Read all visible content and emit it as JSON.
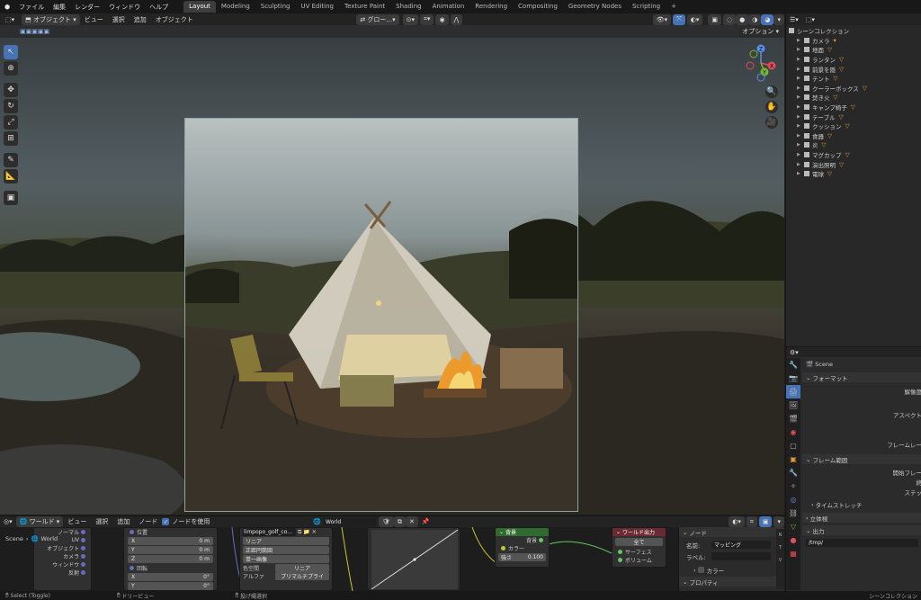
{
  "menubar": {
    "items": [
      "ファイル",
      "編集",
      "レンダー",
      "ウィンドウ",
      "ヘルプ"
    ],
    "workspaces": [
      "Layout",
      "Modeling",
      "Sculpting",
      "UV Editing",
      "Texture Paint",
      "Shading",
      "Animation",
      "Rendering",
      "Compositing",
      "Geometry Nodes",
      "Scripting"
    ],
    "add_tab": "+"
  },
  "viewport": {
    "mode": "オブジェクト",
    "menus": [
      "ビュー",
      "選択",
      "追加",
      "オブジェクト"
    ],
    "transform": "グロー...",
    "options": "オプション"
  },
  "gizmo": {
    "z": "Z",
    "x": "X",
    "y": "Y"
  },
  "outliner": {
    "title": "シーンコレクション",
    "items": [
      "カメラ",
      "地面",
      "ランタン",
      "前景を隠",
      "テント",
      "クーラーボックス",
      "焚き火",
      "キャンプ椅子",
      "テーブル",
      "クッション",
      "食器",
      "炎",
      "マグカップ",
      "演出照明",
      "電球"
    ]
  },
  "properties": {
    "scene": "Scene",
    "format_section": "フォーマット",
    "labels": [
      "解像度",
      "アスペクト",
      "フレームレー"
    ],
    "frame_range": "フレーム範囲",
    "frame_labels": [
      "開始フレー",
      "終",
      "ステッ"
    ],
    "time_stretch": "タイムストレッチ",
    "stereo": "立体視",
    "output": "出力",
    "output_path": "/tmp/"
  },
  "node_editor": {
    "world_dropdown": "ワールド",
    "menus": [
      "ビュー",
      "選択",
      "追加",
      "ノード"
    ],
    "use_nodes": "ノードを使用",
    "world_name": "World",
    "scene_label": "Scene",
    "tree": [
      "ノーマル",
      "UV",
      "オブジェクト",
      "カメラ",
      "ウィンドウ",
      "反射"
    ],
    "tree_top": "World",
    "image_name": "limpopo_golf_co...",
    "image_opts": [
      "リニア",
      "正距円筒図",
      "単一画像",
      "色空間",
      "アルファ"
    ],
    "colorspace": "リニア",
    "alpha": "プリマルチプライ",
    "loc_label": "位置",
    "rot_label": "回転",
    "vals": [
      "0 m",
      "0 m",
      "0 m",
      "0°",
      "0°",
      "61°"
    ],
    "xyz": [
      "X",
      "Y",
      "Z"
    ],
    "bg_node": "背景",
    "bg_rows": [
      "背景",
      "カラー",
      "強さ"
    ],
    "strength": "0.100",
    "out_node": "ワールド出力",
    "out_rows": [
      "全て",
      "サーフェス",
      "ボリューム"
    ],
    "side_title": "ノード",
    "name_label": "名前:",
    "name_value": "マッピング",
    "label_label": "ラベル:",
    "color_label": "カラー",
    "props_label": "プロパティ"
  },
  "statusbar": {
    "left": "Select (Toggle)",
    "mid": "ドリービュー",
    "mid2": "投げ縄選択",
    "right": "シーンコレクション"
  }
}
